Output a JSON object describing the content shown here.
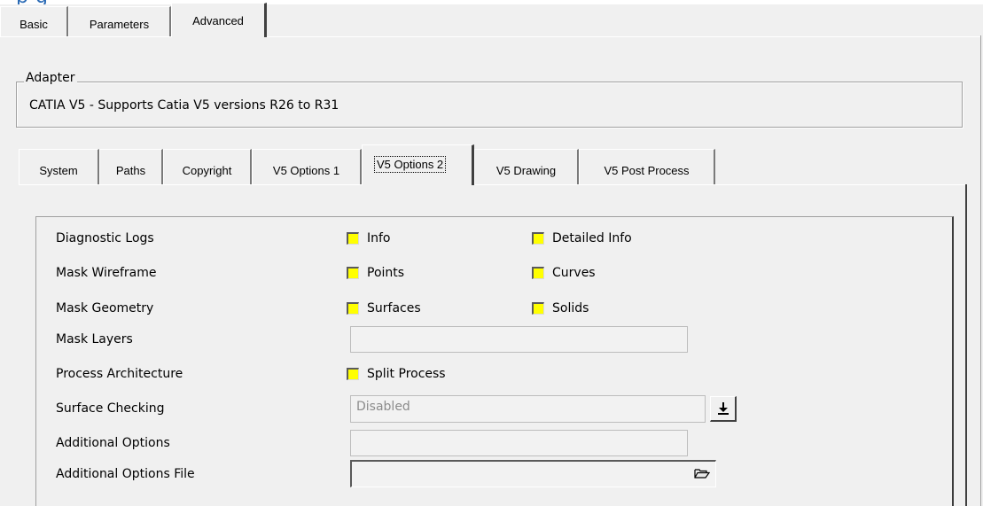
{
  "top_tabs": [
    {
      "label": "Basic",
      "selected": false
    },
    {
      "label": "Parameters",
      "selected": false
    },
    {
      "label": "Advanced",
      "selected": true
    }
  ],
  "adapter": {
    "legend": "Adapter",
    "text": "CATIA V5  -  Supports Catia V5 versions R26 to R31"
  },
  "sub_tabs": [
    {
      "label": "System",
      "selected": false
    },
    {
      "label": "Paths",
      "selected": false
    },
    {
      "label": "Copyright",
      "selected": false
    },
    {
      "label": "V5 Options 1",
      "selected": false
    },
    {
      "label": "V5 Options 2",
      "selected": true
    },
    {
      "label": "V5 Drawing",
      "selected": false
    },
    {
      "label": "V5 Post Process",
      "selected": false
    }
  ],
  "options": {
    "diagnostic_logs": {
      "label": "Diagnostic Logs",
      "check1": "Info",
      "check2": "Detailed Info"
    },
    "mask_wireframe": {
      "label": "Mask Wireframe",
      "check1": "Points",
      "check2": "Curves"
    },
    "mask_geometry": {
      "label": "Mask Geometry",
      "check1": "Surfaces",
      "check2": "Solids"
    },
    "mask_layers": {
      "label": "Mask Layers",
      "value": ""
    },
    "process_architecture": {
      "label": "Process Architecture",
      "check1": "Split Process"
    },
    "surface_checking": {
      "label": "Surface Checking",
      "value": "Disabled"
    },
    "additional_options": {
      "label": "Additional Options",
      "value": ""
    },
    "additional_options_file": {
      "label": "Additional Options File",
      "value": ""
    }
  },
  "colors": {
    "checkbox_fill": "#ffff00",
    "header_text": "#2a6ab5"
  },
  "icons": {
    "dropdown": "down-arrow-bar-icon",
    "browse": "folder-open-icon"
  }
}
